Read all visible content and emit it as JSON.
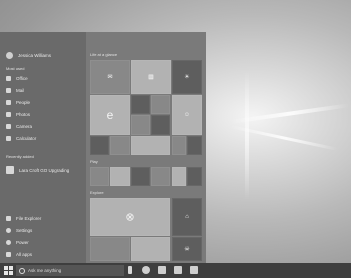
{
  "start_menu": {
    "user": {
      "name": "Jessica Williams"
    },
    "most_used_label": "Most used",
    "most_used": [
      {
        "label": "Office",
        "icon": "office-icon"
      },
      {
        "label": "Mail",
        "icon": "mail-icon"
      },
      {
        "label": "People",
        "icon": "people-icon"
      },
      {
        "label": "Photos",
        "icon": "photos-icon"
      },
      {
        "label": "Camera",
        "icon": "camera-icon"
      },
      {
        "label": "Calculator",
        "icon": "calculator-icon"
      }
    ],
    "recently_added_label": "Recently added",
    "recently_added": [
      {
        "label": "Lara Croft GO Upgrading",
        "icon": "game-icon"
      }
    ],
    "bottom": [
      {
        "label": "File Explorer",
        "icon": "folder-icon"
      },
      {
        "label": "Settings",
        "icon": "gear-icon"
      },
      {
        "label": "Power",
        "icon": "power-icon"
      },
      {
        "label": "All apps",
        "icon": "list-icon"
      }
    ],
    "groups": {
      "life_label": "Life at a glance",
      "play_label": "Play",
      "explore_label": "Explore"
    },
    "tiles": {
      "mail_tile": "Mail",
      "calendar_tile": "Calendar",
      "weather_tile": "Weather",
      "edge_tile": "Microsoft Edge",
      "photos_tile": "Photos",
      "xbox_tile": "Xbox",
      "store_tile": "Store"
    }
  },
  "taskbar": {
    "search_placeholder": "Ask me anything",
    "icons": [
      "microphone-icon",
      "task-view-icon",
      "edge-icon",
      "explorer-icon",
      "store-icon"
    ]
  }
}
